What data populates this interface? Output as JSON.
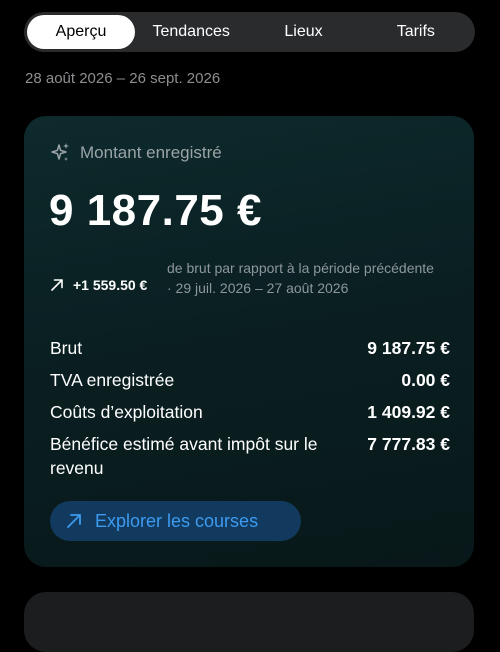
{
  "tabs": [
    {
      "label": "Aperçu",
      "active": true
    },
    {
      "label": "Tendances",
      "active": false
    },
    {
      "label": "Lieux",
      "active": false
    },
    {
      "label": "Tarifs",
      "active": false
    }
  ],
  "date_range": "28 août 2026 – 26 sept. 2026",
  "card": {
    "title": "Montant enregistré",
    "title_icon": "sparkle-icon",
    "amount": "9 187.75 €",
    "delta": {
      "icon": "arrow-up-right-icon",
      "value": "+1 559.50 €",
      "description": "de brut par rapport à la période précédente · 29 juil. 2026 – 27 août 2026"
    },
    "rows": [
      {
        "label": "Brut",
        "value": "9 187.75 €"
      },
      {
        "label": "TVA enregistrée",
        "value": "0.00 €"
      },
      {
        "label": "Coûts d’exploitation",
        "value": "1 409.92 €"
      },
      {
        "label": "Bénéfice estimé avant impôt sur le revenu",
        "value": "7 777.83 €"
      }
    ],
    "button": {
      "label": "Explorer les courses",
      "icon": "arrow-up-right-icon"
    }
  },
  "colors": {
    "background": "#000000",
    "card_accent": "#0e2a2c",
    "link_blue": "#3c9bf0",
    "button_bg": "#123a5e",
    "muted_text": "#8d8e91"
  }
}
